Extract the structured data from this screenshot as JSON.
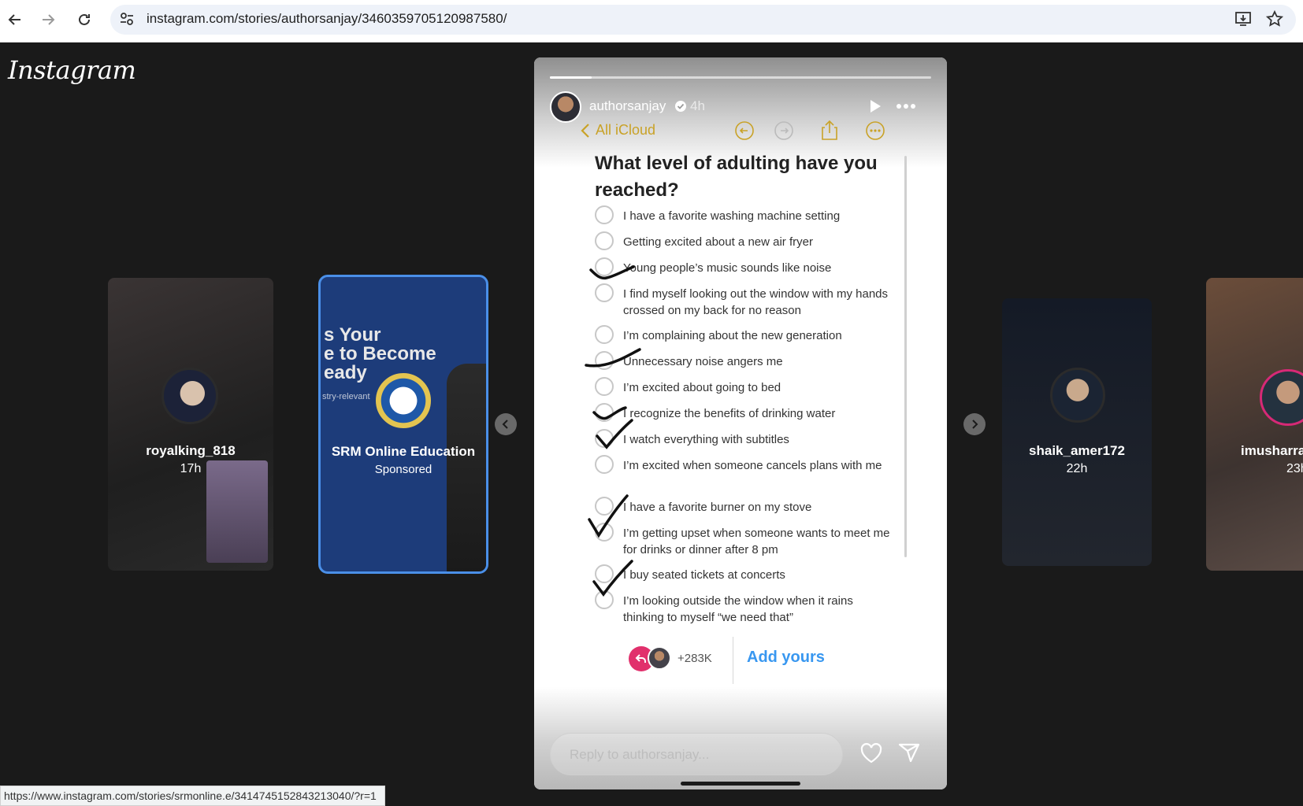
{
  "browser": {
    "url": "instagram.com/stories/authorsanjay/3460359705120987580/",
    "status_url": "https://www.instagram.com/stories/srmonline.e/3414745152843213040/?r=1"
  },
  "header": {
    "logo": "Instagram"
  },
  "side_stories": [
    {
      "username": "royalking_818",
      "time": "17h"
    },
    {
      "username": "SRM Online Education",
      "time": "Sponsored",
      "card_text_1": "s Your",
      "card_text_2": "e to Become",
      "card_text_3": "eady",
      "card_text_4": "stry-relevant"
    },
    {
      "username": "shaik_amer172",
      "time": "22h"
    },
    {
      "username": "imusharra",
      "time": "23h"
    }
  ],
  "story": {
    "username": "authorsanjay",
    "time": "4h",
    "progress": 0.11,
    "icloud_back": "All iCloud",
    "note_title": "What level of adulting have you reached?",
    "items": [
      "I have a favorite washing machine setting",
      "Getting excited about a new air fryer",
      "Young people’s music sounds like noise",
      "I find myself looking out the window with my hands crossed on my back for no reason",
      "I’m complaining about the new generation",
      "Unnecessary noise angers me",
      "I’m excited about going to bed",
      "I recognize the benefits of drinking water",
      "I watch everything with subtitles",
      "I’m excited when someone cancels plans with me",
      "I have a favorite burner on my stove",
      "I’m getting upset when someone wants to meet me for drinks or dinner after 8 pm",
      "I buy seated tickets at concerts",
      "I’m looking outside the window when it rains thinking to myself “we need that”"
    ],
    "add_yours_count": "+283K",
    "add_yours_label": "Add yours",
    "reply_placeholder": "Reply to authorsanjay..."
  },
  "icons": [
    "back-icon",
    "forward-icon",
    "reload-icon",
    "site-settings-icon",
    "install-icon",
    "bookmark-star-icon",
    "verified-icon",
    "play-icon",
    "more-icon",
    "heart-icon",
    "send-icon",
    "chevron-left-icon",
    "chevron-right-icon"
  ],
  "colors": {
    "accent_blue": "#3897f0",
    "icloud_gold": "#c9a227",
    "background": "#1a1a1a"
  }
}
